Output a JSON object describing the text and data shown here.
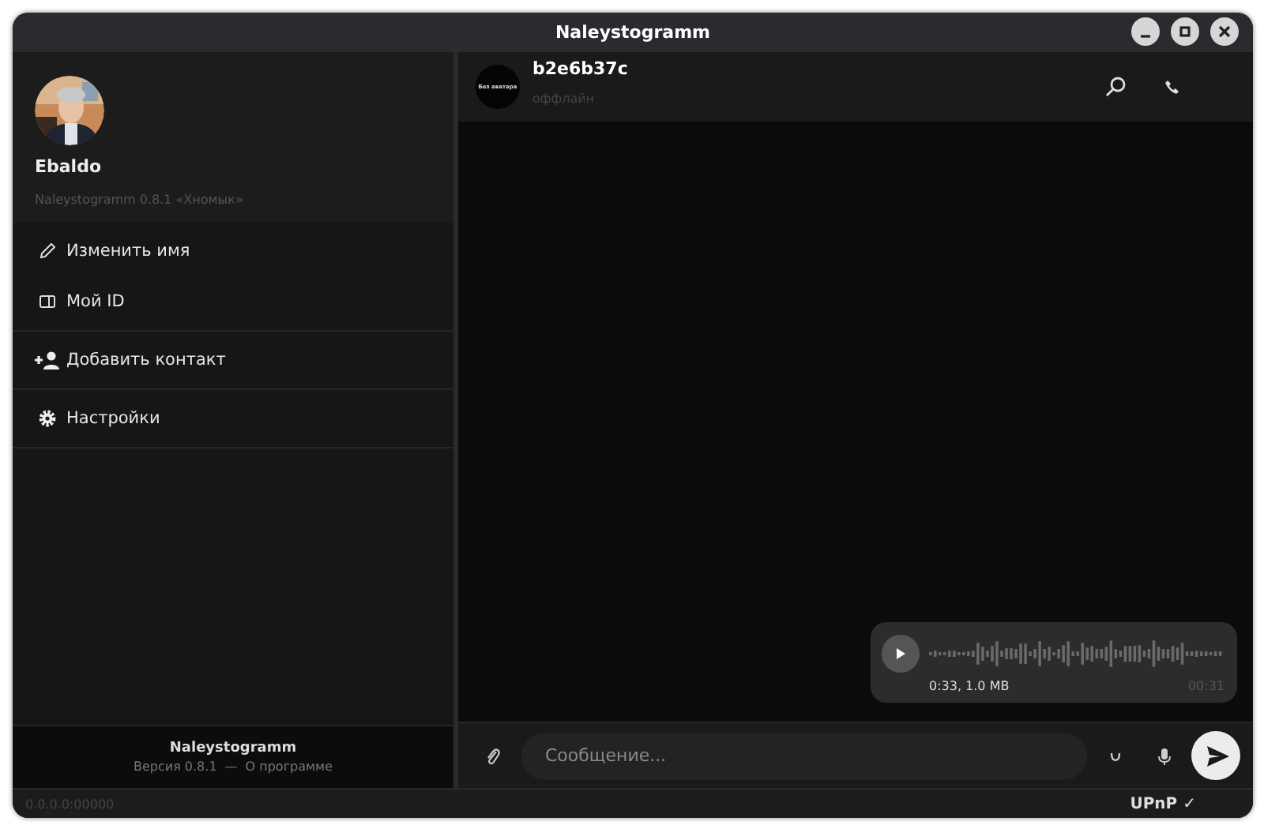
{
  "window": {
    "title": "Naleystogramm"
  },
  "profile": {
    "name": "Ebaldo",
    "subtitle": "Naleystogramm 0.8.1 «Хномык»"
  },
  "menu_groups": [
    [
      {
        "kind": "rename",
        "label": "Изменить имя"
      },
      {
        "kind": "id",
        "label": "Мой ID"
      }
    ],
    [
      {
        "kind": "add-contact",
        "label": "Добавить контакт"
      }
    ],
    [
      {
        "kind": "settings",
        "label": "Настройки"
      }
    ]
  ],
  "sidebar_footer": {
    "app_name": "Naleystogramm",
    "version": "Версия 0.8.1",
    "separator": "—",
    "about_link": "О программе"
  },
  "chat": {
    "contact": {
      "avatar_text": "Без аватара",
      "name": "b2e6b37c",
      "status": "оффлайн"
    },
    "messages": [
      {
        "kind": "voice",
        "info": "0:33, 1.0 MB",
        "time": "00:31"
      }
    ],
    "composer": {
      "placeholder": "Сообщение..."
    }
  },
  "status_bar": {
    "address": "0.0.0.0:00000",
    "upnp": "UPnP ✓"
  }
}
